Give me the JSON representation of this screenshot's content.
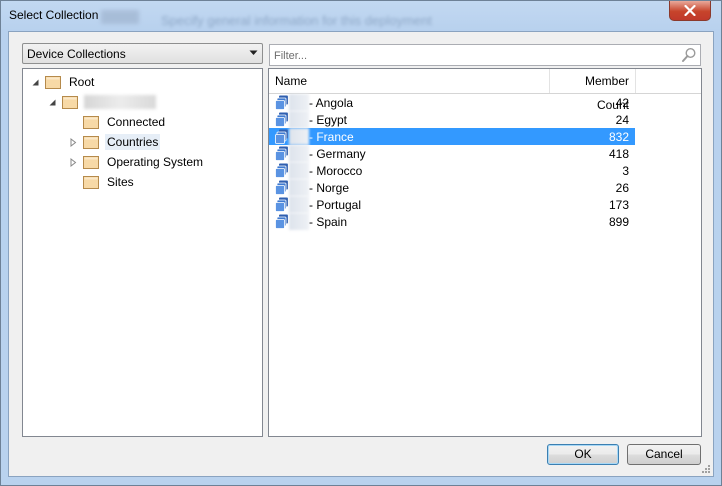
{
  "window": {
    "title": "Select Collection",
    "background_caption": "Specify general information for this deployment",
    "close_label": "×"
  },
  "collection_type": {
    "selected": "Device Collections"
  },
  "tree": {
    "root": "Root",
    "items": [
      "Connected",
      "Countries",
      "Operating System",
      "Sites"
    ]
  },
  "filter": {
    "placeholder": "Filter..."
  },
  "list": {
    "columns": {
      "name": "Name",
      "member_count": "Member Count"
    },
    "rows": [
      {
        "name": "- Angola",
        "count": "42",
        "selected": false
      },
      {
        "name": "- Egypt",
        "count": "24",
        "selected": false
      },
      {
        "name": "- France",
        "count": "832",
        "selected": true
      },
      {
        "name": "- Germany",
        "count": "418",
        "selected": false
      },
      {
        "name": "- Morocco",
        "count": "3",
        "selected": false
      },
      {
        "name": "- Norge",
        "count": "26",
        "selected": false
      },
      {
        "name": "- Portugal",
        "count": "173",
        "selected": false
      },
      {
        "name": "- Spain",
        "count": "899",
        "selected": false
      }
    ]
  },
  "buttons": {
    "ok": "OK",
    "cancel": "Cancel"
  },
  "colors": {
    "selection": "#3399ff",
    "folder": "#f7d9a6",
    "close": "#c7442b"
  },
  "icons": {
    "close": "close-icon",
    "dropdown": "chevron-down-icon",
    "search": "search-icon",
    "folder": "folder-icon",
    "collection": "collection-icon"
  }
}
